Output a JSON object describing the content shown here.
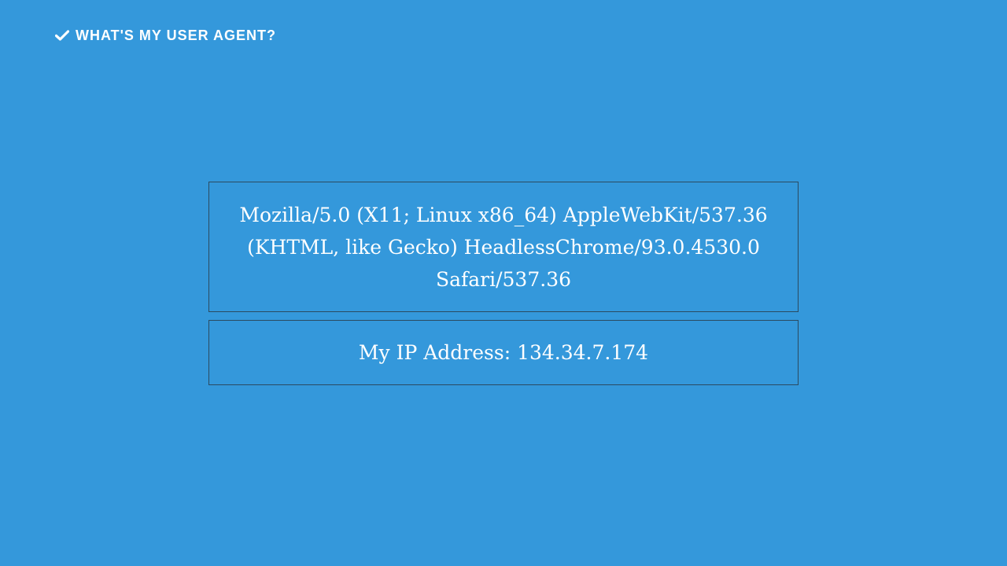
{
  "header": {
    "title": "WHAT'S MY USER AGENT?",
    "icon": "check-icon"
  },
  "user_agent": {
    "value": "Mozilla/5.0 (X11; Linux x86_64) AppleWebKit/537.36 (KHTML, like Gecko) HeadlessChrome/93.0.4530.0 Safari/537.36"
  },
  "ip": {
    "label": "My IP Address:",
    "value": "134.34.7.174",
    "display": "My IP Address: 134.34.7.174"
  },
  "colors": {
    "background": "#3498db",
    "text": "#ffffff",
    "box_border": "#2b4a60"
  }
}
